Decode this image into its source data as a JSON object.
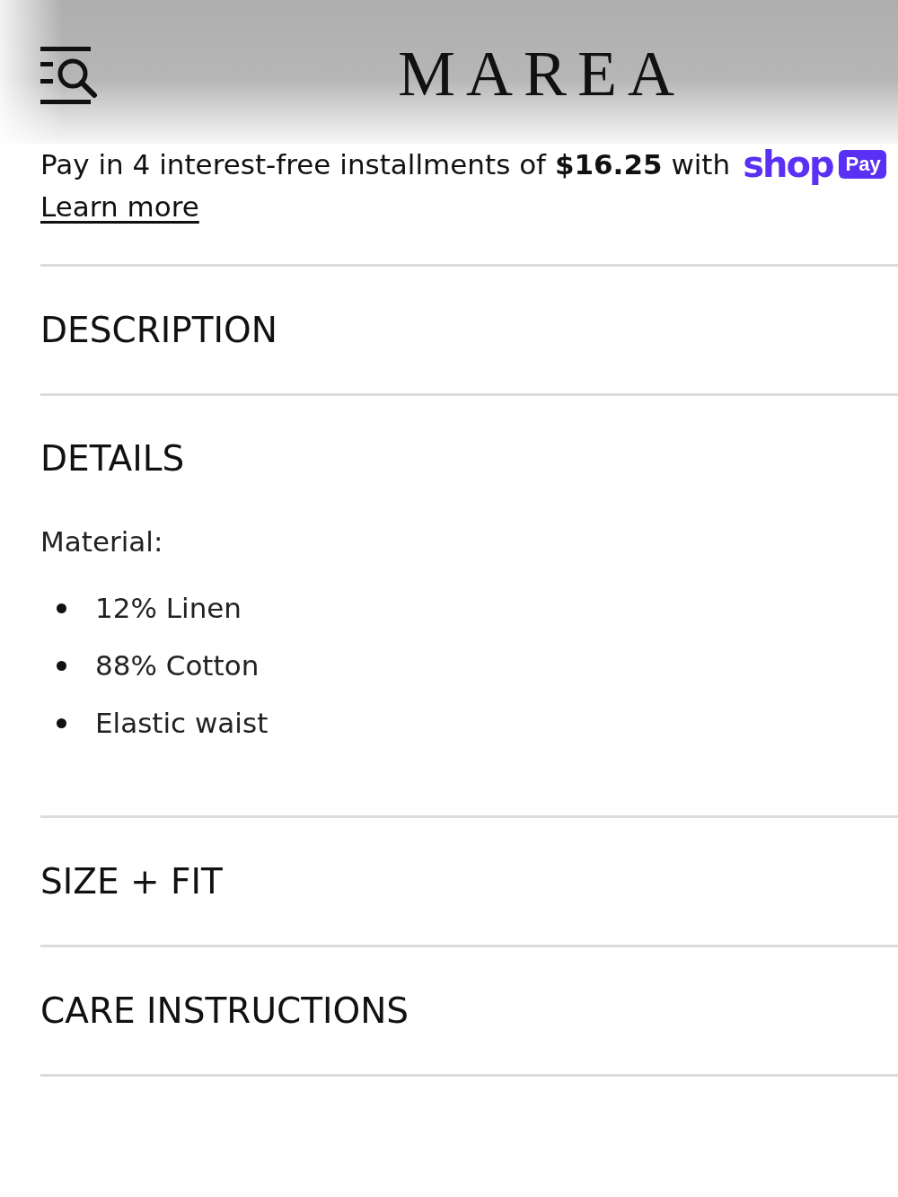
{
  "header": {
    "logo": "MAREA"
  },
  "installments": {
    "text": "Pay in 4 interest-free installments of **$16.25** with",
    "brand": "shop",
    "badge": "Pay",
    "link": "Learn more"
  },
  "sections": [
    {
      "title": "DESCRIPTION"
    },
    {
      "title": "DETAILS",
      "content": {
        "label": "Material:",
        "bullets": [
          "12% Linen",
          "88% Cotton",
          "Elastic waist"
        ]
      }
    },
    {
      "title": "SIZE + FIT"
    },
    {
      "title": "CARE INSTRUCTIONS"
    }
  ]
}
